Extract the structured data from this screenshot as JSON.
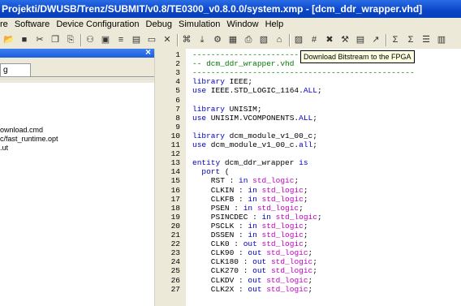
{
  "window": {
    "title": "Projekti/DWUSB/Trenz/SUBMIT/v0.8/TE0300_v0.8.0.0/system.xmp - [dcm_ddr_wrapper.vhd]"
  },
  "menu": [
    "re",
    "Software",
    "Device Configuration",
    "Debug",
    "Simulation",
    "Window",
    "Help"
  ],
  "tooltip": "Download Bitstream to the FPGA",
  "left_panel": {
    "tab": "g",
    "files": [
      "ownload.cmd",
      "c/fast_runtime.opt",
      ".ut"
    ]
  },
  "editor": {
    "lines": [
      [
        {
          "t": "------------------------------------------------",
          "c": "cm"
        }
      ],
      [
        {
          "t": "-- dcm_ddr_wrapper.vhd",
          "c": "cm"
        }
      ],
      [
        {
          "t": "------------------------------------------------",
          "c": "cm"
        }
      ],
      [
        {
          "t": "library",
          "c": "kw"
        },
        {
          "t": " IEEE;",
          "c": ""
        }
      ],
      [
        {
          "t": "use",
          "c": "kw"
        },
        {
          "t": " IEEE.STD_LOGIC_1164.",
          "c": ""
        },
        {
          "t": "ALL",
          "c": "kw"
        },
        {
          "t": ";",
          "c": ""
        }
      ],
      [
        {
          "t": "",
          "c": ""
        }
      ],
      [
        {
          "t": "library",
          "c": "kw"
        },
        {
          "t": " UNISIM;",
          "c": ""
        }
      ],
      [
        {
          "t": "use",
          "c": "kw"
        },
        {
          "t": " UNISIM.VCOMPONENTS.",
          "c": ""
        },
        {
          "t": "ALL",
          "c": "kw"
        },
        {
          "t": ";",
          "c": ""
        }
      ],
      [
        {
          "t": "",
          "c": ""
        }
      ],
      [
        {
          "t": "library",
          "c": "kw"
        },
        {
          "t": " dcm_module_v1_00_c;",
          "c": ""
        }
      ],
      [
        {
          "t": "use",
          "c": "kw"
        },
        {
          "t": " dcm_module_v1_00_c.",
          "c": ""
        },
        {
          "t": "all",
          "c": "kw"
        },
        {
          "t": ";",
          "c": ""
        }
      ],
      [
        {
          "t": "",
          "c": ""
        }
      ],
      [
        {
          "t": "entity",
          "c": "kw"
        },
        {
          "t": " dcm_ddr_wrapper ",
          "c": ""
        },
        {
          "t": "is",
          "c": "kw"
        }
      ],
      [
        {
          "t": "  ",
          "c": ""
        },
        {
          "t": "port",
          "c": "kw"
        },
        {
          "t": " (",
          "c": ""
        }
      ],
      [
        {
          "t": "    RST : ",
          "c": ""
        },
        {
          "t": "in",
          "c": "kw"
        },
        {
          "t": " ",
          "c": ""
        },
        {
          "t": "std_logic",
          "c": "ty"
        },
        {
          "t": ";",
          "c": ""
        }
      ],
      [
        {
          "t": "    CLKIN : ",
          "c": ""
        },
        {
          "t": "in",
          "c": "kw"
        },
        {
          "t": " ",
          "c": ""
        },
        {
          "t": "std_logic",
          "c": "ty"
        },
        {
          "t": ";",
          "c": ""
        }
      ],
      [
        {
          "t": "    CLKFB : ",
          "c": ""
        },
        {
          "t": "in",
          "c": "kw"
        },
        {
          "t": " ",
          "c": ""
        },
        {
          "t": "std_logic",
          "c": "ty"
        },
        {
          "t": ";",
          "c": ""
        }
      ],
      [
        {
          "t": "    PSEN : ",
          "c": ""
        },
        {
          "t": "in",
          "c": "kw"
        },
        {
          "t": " ",
          "c": ""
        },
        {
          "t": "std_logic",
          "c": "ty"
        },
        {
          "t": ";",
          "c": ""
        }
      ],
      [
        {
          "t": "    PSINCDEC : ",
          "c": ""
        },
        {
          "t": "in",
          "c": "kw"
        },
        {
          "t": " ",
          "c": ""
        },
        {
          "t": "std_logic",
          "c": "ty"
        },
        {
          "t": ";",
          "c": ""
        }
      ],
      [
        {
          "t": "    PSCLK : ",
          "c": ""
        },
        {
          "t": "in",
          "c": "kw"
        },
        {
          "t": " ",
          "c": ""
        },
        {
          "t": "std_logic",
          "c": "ty"
        },
        {
          "t": ";",
          "c": ""
        }
      ],
      [
        {
          "t": "    DSSEN : ",
          "c": ""
        },
        {
          "t": "in",
          "c": "kw"
        },
        {
          "t": " ",
          "c": ""
        },
        {
          "t": "std_logic",
          "c": "ty"
        },
        {
          "t": ";",
          "c": ""
        }
      ],
      [
        {
          "t": "    CLK0 : ",
          "c": ""
        },
        {
          "t": "out",
          "c": "kw"
        },
        {
          "t": " ",
          "c": ""
        },
        {
          "t": "std_logic",
          "c": "ty"
        },
        {
          "t": ";",
          "c": ""
        }
      ],
      [
        {
          "t": "    CLK90 : ",
          "c": ""
        },
        {
          "t": "out",
          "c": "kw"
        },
        {
          "t": " ",
          "c": ""
        },
        {
          "t": "std_logic",
          "c": "ty"
        },
        {
          "t": ";",
          "c": ""
        }
      ],
      [
        {
          "t": "    CLK180 : ",
          "c": ""
        },
        {
          "t": "out",
          "c": "kw"
        },
        {
          "t": " ",
          "c": ""
        },
        {
          "t": "std_logic",
          "c": "ty"
        },
        {
          "t": ";",
          "c": ""
        }
      ],
      [
        {
          "t": "    CLK270 : ",
          "c": ""
        },
        {
          "t": "out",
          "c": "kw"
        },
        {
          "t": " ",
          "c": ""
        },
        {
          "t": "std_logic",
          "c": "ty"
        },
        {
          "t": ";",
          "c": ""
        }
      ],
      [
        {
          "t": "    CLKDV : ",
          "c": ""
        },
        {
          "t": "out",
          "c": "kw"
        },
        {
          "t": " ",
          "c": ""
        },
        {
          "t": "std_logic",
          "c": "ty"
        },
        {
          "t": ";",
          "c": ""
        }
      ],
      [
        {
          "t": "    CLK2X : ",
          "c": ""
        },
        {
          "t": "out",
          "c": "kw"
        },
        {
          "t": " ",
          "c": ""
        },
        {
          "t": "std_logic",
          "c": "ty"
        },
        {
          "t": ";",
          "c": ""
        }
      ]
    ]
  },
  "toolbar_icons": [
    "open-icon",
    "save-icon",
    "cut-icon",
    "copy-icon",
    "paste-icon",
    "find-icon",
    "box-icon",
    "tree-icon",
    "chart-icon",
    "window-icon",
    "close-icon",
    "bitstream-icon",
    "download-icon",
    "compile-icon",
    "library-icon",
    "print-icon",
    "board-icon",
    "home-icon",
    "grid-icon",
    "hash-icon",
    "cross-icon",
    "tool-icon",
    "doc-icon",
    "graph-icon",
    "sigma-icon",
    "sum-icon",
    "list-icon",
    "panel-icon"
  ]
}
